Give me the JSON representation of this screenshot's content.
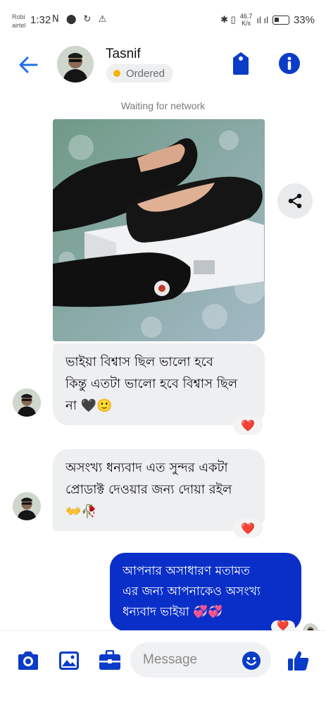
{
  "status_bar": {
    "carrier_line1": "Robi",
    "carrier_line2": "airtel",
    "time": "1:32",
    "left_icons": "N ⬤ ↻ ⚠",
    "bluetooth_vibrate": "✱ ▯",
    "net_speed_value": "46.7",
    "net_speed_unit": "K/s",
    "signal": "ıl ıl",
    "battery_percent": "33%"
  },
  "header": {
    "contact_name": "Tasnif",
    "order_status": "Ordered",
    "order_status_color": "#f4b400",
    "accent_color": "#1f6fe6",
    "icons": [
      "back-arrow-icon",
      "tag-icon",
      "info-icon"
    ]
  },
  "conversation": {
    "network_status": "Waiting for network",
    "messages": [
      {
        "direction": "incoming",
        "text": "ভাইয়া বিশ্বাস ছিল ভালো হবে কিন্তু এতটা ভালো হবে বিশ্বাস ছিল না 🖤🙂",
        "line1": "ভাইয়া বিশ্বাস ছিল ভালো হবে",
        "line2": "কিন্তু এতটা ভালো হবে বিশ্বাস ছিল",
        "line3": "না 🖤🙂",
        "reaction": "❤️"
      },
      {
        "direction": "incoming",
        "text": "অসংখ্য ধন্যবাদ এত সুন্দর একটা প্রোডাক্ট দেওয়ার জন্য দোয়া রইল 👐🥀",
        "line1": "অসংখ্য ধন্যবাদ এত সুন্দর একটা",
        "line2": "প্রোডাক্ট দেওয়ার জন্য দোয়া রইল",
        "line3": "👐🥀",
        "reaction": "❤️"
      },
      {
        "direction": "outgoing",
        "text": "আপনার অসাধারণ মতামত এর জন্য আপনাকেও অসংখ্য ধন্যবাদ ভাইয়া 💞💞",
        "line1": "আপনার অসাধারণ মতামত",
        "line2": "এর জন্য আপনাকেও অসংখ্য",
        "line3": "ধন্যবাদ ভাইয়া 💞💞",
        "reaction": "❤️",
        "bubble_color": "#0a2fc8"
      }
    ]
  },
  "composer": {
    "placeholder": "Message",
    "icons": [
      "camera-icon",
      "gallery-icon",
      "briefcase-icon",
      "emoji-icon",
      "thumbs-up-icon"
    ],
    "icon_color": "#0a3cc8"
  }
}
